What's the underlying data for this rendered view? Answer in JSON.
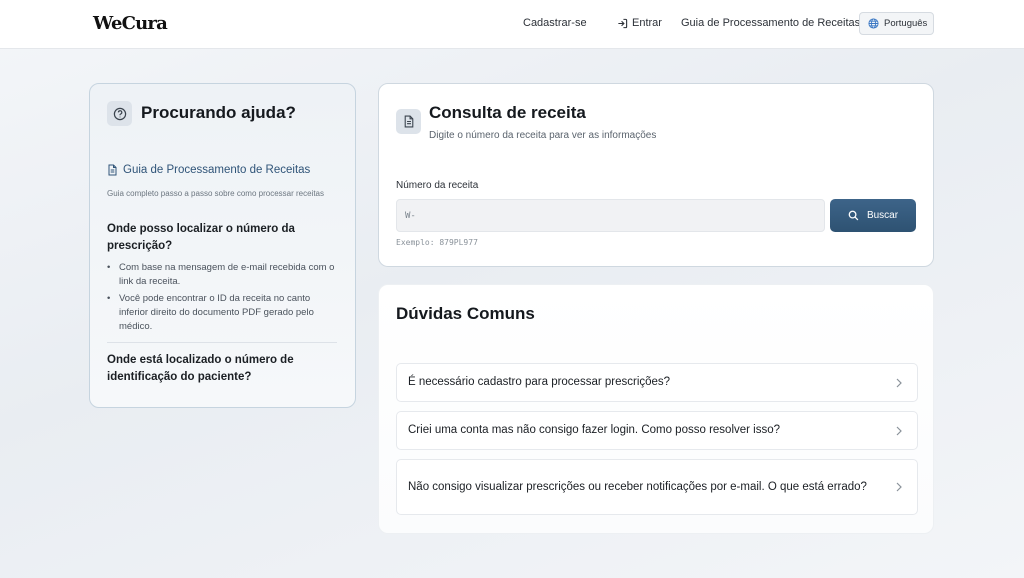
{
  "header": {
    "logo": "WeCura",
    "nav": {
      "signup": "Cadastrar-se",
      "login": "Entrar",
      "guide": "Guia de Processamento de Receitas",
      "language": "Português"
    }
  },
  "help": {
    "title": "Procurando ajuda?",
    "guide_link": "Guia de Processamento de Receitas",
    "guide_desc": "Guia completo passo a passo sobre como processar receitas",
    "q1": "Onde posso localizar o número da prescrição?",
    "q1_bullets": [
      "Com base na mensagem de e-mail recebida com o link da receita.",
      "Você pode encontrar o ID da receita no canto inferior direito do documento PDF gerado pelo médico."
    ],
    "q2": "Onde está localizado o número de identificação do paciente?"
  },
  "consulta": {
    "title": "Consulta de receita",
    "subtitle": "Digite o número da receita para ver as informações",
    "label": "Número da receita",
    "input_value": "W-",
    "button": "Buscar",
    "example": "Exemplo: 879PL977"
  },
  "faq": {
    "title": "Dúvidas Comuns",
    "items": [
      "É necessário cadastro para processar prescrições?",
      "Criei uma conta mas não consigo fazer login. Como posso resolver isso?",
      "Não consigo visualizar prescrições ou receber notificações por e-mail. O que está errado?"
    ]
  }
}
